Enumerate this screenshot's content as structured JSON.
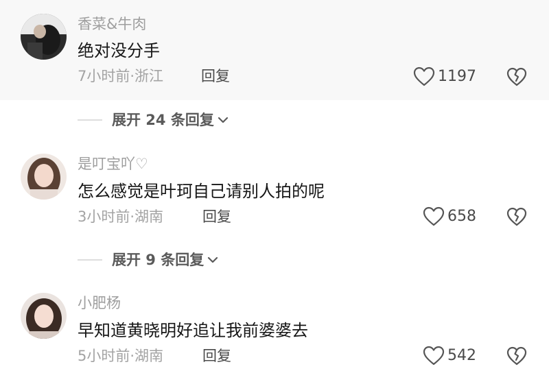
{
  "comments": [
    {
      "user": "香菜&牛肉",
      "text": "绝对没分手",
      "meta": "7小时前·浙江",
      "reply_label": "回复",
      "likes": "1197",
      "expand_label": "展开 24 条回复"
    },
    {
      "user": "是叮宝吖♡",
      "text": "怎么感觉是叶珂自己请别人拍的呢",
      "meta": "3小时前·湖南",
      "reply_label": "回复",
      "likes": "658",
      "expand_label": "展开 9 条回复"
    },
    {
      "user": "小肥杨",
      "text": "早知道黄晓明好追让我前婆婆去",
      "meta": "5小时前·湖南",
      "reply_label": "回复",
      "likes": "542"
    }
  ],
  "icons": {
    "like": "heart-outline-icon",
    "dislike": "broken-heart-icon",
    "expand": "chevron-down-icon"
  },
  "colors": {
    "highlight_bg": "#f8f8f8",
    "username": "#9e9e9e",
    "body_text": "#161616",
    "meta_text": "#a3a3a3"
  }
}
